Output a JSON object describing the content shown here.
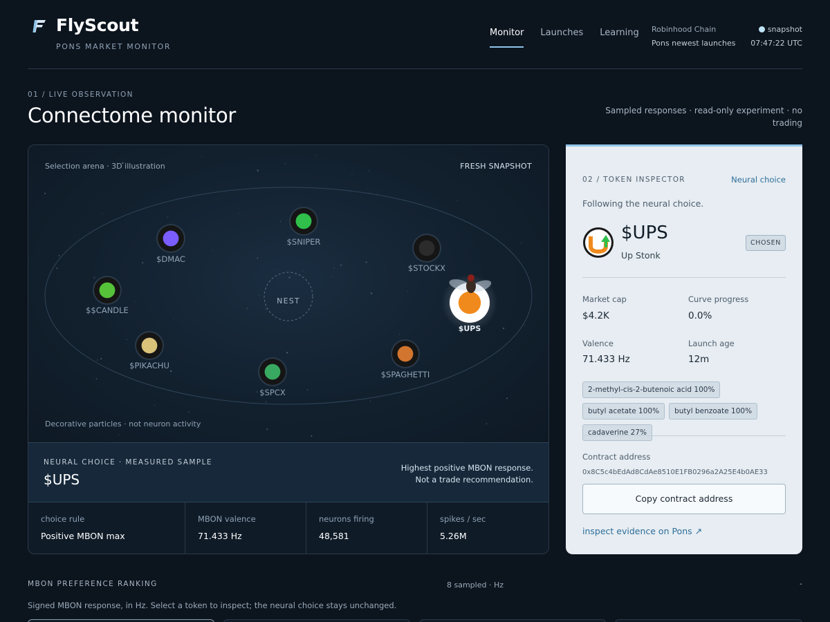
{
  "header": {
    "brand": "FlyScout",
    "tagline": "PONS MARKET MONITOR",
    "nav": [
      {
        "label": "Monitor",
        "active": true
      },
      {
        "label": "Launches",
        "active": false
      },
      {
        "label": "Learning",
        "active": false
      }
    ],
    "chain_name": "Robinhood Chain",
    "chain_sub": "Pons newest launches",
    "snapshot_label": "snapshot",
    "snapshot_time": "07:47:22 UTC"
  },
  "section": {
    "label": "01 / LIVE OBSERVATION",
    "title": "Connectome monitor",
    "note": "Sampled responses · read-only experiment · no trading"
  },
  "arena": {
    "caption": "Selection arena · 3D illustration",
    "fresh": "FRESH SNAPSHOT",
    "nest": "NEST",
    "footnote": "Decorative particles · not neuron activity",
    "tokens": [
      {
        "ticker": "$DMAC",
        "color": "#7a5cff",
        "chosen": false
      },
      {
        "ticker": "$SNIPER",
        "color": "#2fbf4a",
        "chosen": false
      },
      {
        "ticker": "$STOCKX",
        "color": "#2b2b2b",
        "chosen": false
      },
      {
        "ticker": "$$CANDLE",
        "color": "#55c23a",
        "chosen": false
      },
      {
        "ticker": "$UPS",
        "color": "#f08a1c",
        "chosen": true
      },
      {
        "ticker": "$PIKACHU",
        "color": "#d9c27a",
        "chosen": false
      },
      {
        "ticker": "$SPAGHETTI",
        "color": "#d2752f",
        "chosen": false
      },
      {
        "ticker": "$SPCX",
        "color": "#39a860",
        "chosen": false
      }
    ]
  },
  "choice": {
    "label": "NEURAL CHOICE · MEASURED SAMPLE",
    "value": "$UPS",
    "note_line1": "Highest positive MBON response.",
    "note_line2": "Not a trade recommendation."
  },
  "stats": [
    {
      "label": "choice rule",
      "value": "Positive MBON max"
    },
    {
      "label": "MBON valence",
      "value": "71.433 Hz"
    },
    {
      "label": "neurons firing",
      "value": "48,581"
    },
    {
      "label": "spikes / sec",
      "value": "5.26M"
    }
  ],
  "inspector": {
    "label": "02 / TOKEN INSPECTOR",
    "neural_choice": "Neural choice",
    "following": "Following the neural choice.",
    "ticker": "$UPS",
    "name": "Up Stonk",
    "badge": "CHOSEN",
    "market_cap_label": "Market cap",
    "market_cap": "$4.2K",
    "curve_label": "Curve progress",
    "curve": "0.0%",
    "valence_label": "Valence",
    "valence": "71.433 Hz",
    "age_label": "Launch age",
    "age": "12m",
    "chips": [
      "2-methyl-cis-2-butenoic acid 100%",
      "butyl acetate 100%",
      "butyl benzoate 100%",
      "cadaverine 27%"
    ],
    "contract_label": "Contract address",
    "contract": "0x8C5c4bEdAd8CdAe8510E1FB0296a2A25E4b0AE33",
    "copy_label": "Copy contract address",
    "pons_link": "inspect evidence on Pons ↗"
  },
  "ranking": {
    "label": "MBON PREFERENCE RANKING",
    "count": "8 sampled · Hz",
    "dash": "-",
    "desc": "Signed MBON response, in Hz. Select a token to inspect; the neural choice stays unchanged."
  },
  "colors": {
    "bg": "#0c141e",
    "accent": "#8fc4e8",
    "inspector_bg": "#e7edf2",
    "link": "#2e6e99"
  }
}
